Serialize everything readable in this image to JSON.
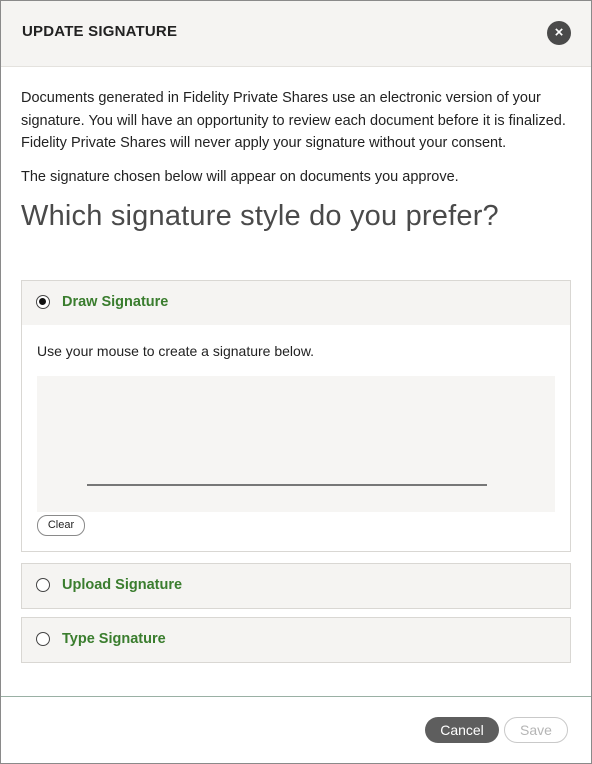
{
  "modal": {
    "title": "UPDATE SIGNATURE",
    "close_icon": "×"
  },
  "content": {
    "intro": "Documents generated in Fidelity Private Shares use an electronic version of your signature. You will have an opportunity to review each document before it is finalized. Fidelity Private Shares will never apply your signature without your consent.",
    "note": "The signature chosen below will appear on documents you approve.",
    "question": "Which signature style do you prefer?"
  },
  "options": {
    "draw": {
      "label": "Draw Signature",
      "selected": true,
      "instruction": "Use your mouse to create a signature below.",
      "clear_label": "Clear"
    },
    "upload": {
      "label": "Upload Signature",
      "selected": false
    },
    "type": {
      "label": "Type Signature",
      "selected": false
    }
  },
  "footer": {
    "cancel_label": "Cancel",
    "save_label": "Save",
    "save_disabled": true
  },
  "colors": {
    "accent_green": "#3a7d2e",
    "header_bg": "#f5f4f2",
    "cancel_bg": "#5e5e5e"
  }
}
